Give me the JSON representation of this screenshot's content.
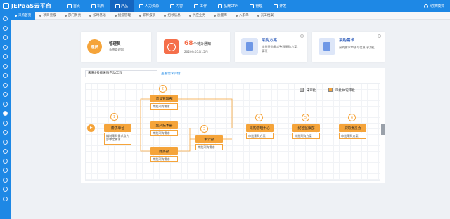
{
  "app": {
    "title": "JEPaaS云平台"
  },
  "nav": {
    "items": [
      {
        "label": "首页",
        "icon": "home-icon",
        "active": false
      },
      {
        "label": "机构",
        "icon": "org-icon",
        "active": false
      },
      {
        "label": "产品",
        "icon": "grid-icon",
        "active": true
      },
      {
        "label": "人力资源",
        "icon": "people-icon",
        "active": false
      },
      {
        "label": "内容",
        "icon": "content-icon",
        "active": false
      },
      {
        "label": "工作",
        "icon": "work-icon",
        "active": false
      },
      {
        "label": "晶耀CRM",
        "icon": "crm-icon",
        "active": false
      },
      {
        "label": "管理",
        "icon": "admin-icon",
        "active": false
      },
      {
        "label": "开发",
        "icon": "dev-icon",
        "active": false
      }
    ],
    "right_label": "切换模式"
  },
  "tabs": [
    {
      "label": "采购首页",
      "active": true
    },
    {
      "label": "项目重报",
      "active": false
    },
    {
      "label": "部门负责",
      "active": false
    },
    {
      "label": "按时基础",
      "active": false
    },
    {
      "label": "招投管理",
      "active": false
    },
    {
      "label": "职称报表",
      "active": false
    },
    {
      "label": "招领信息",
      "active": false
    },
    {
      "label": "供应业务",
      "active": false
    },
    {
      "label": "质量库",
      "active": false
    },
    {
      "label": "入职单",
      "active": false
    },
    {
      "label": "员工档案",
      "active": false
    }
  ],
  "cards": {
    "user": {
      "avatar": "理员",
      "name": "管理员",
      "role": "系统管理部"
    },
    "todo": {
      "count": "68",
      "label": "个待办通知",
      "date": "2020年05月15日"
    },
    "plan": {
      "title": "采购方案",
      "desc1": "审批采购需求整理采购方案、",
      "desc2": "事项"
    },
    "demand": {
      "title": "采购需求",
      "desc": "采购需求审核与信息化功能。"
    }
  },
  "flow": {
    "select_value": "未来8号楼采购启动工程",
    "link": "查看需求详情",
    "legend": [
      {
        "label": "未审批",
        "color": "#bfbfbf"
      },
      {
        "label": "审批中/已审批",
        "color": "#f5a43a"
      }
    ],
    "steps": [
      "1",
      "2",
      "3",
      "4",
      "5",
      "6"
    ],
    "nodes": {
      "n1": {
        "title": "需求单位",
        "sub": "编制采购需求及内部审定需求"
      },
      "n2a": {
        "title": "监督管理部",
        "sub": "审批采购需求"
      },
      "n2b": {
        "title": "生产技术部",
        "sub": "审批采购需求"
      },
      "n2c": {
        "title": "财务部",
        "sub": "审批采购需求"
      },
      "n3": {
        "title": "审计部",
        "sub": "审批采购需求"
      },
      "n4": {
        "title": "采购管理中心",
        "sub": "审批采购方案"
      },
      "n5": {
        "title": "纪检监察部",
        "sub": "审批采购方案"
      },
      "n6": {
        "title": "采购委员会",
        "sub": "审批采购方案"
      }
    }
  }
}
